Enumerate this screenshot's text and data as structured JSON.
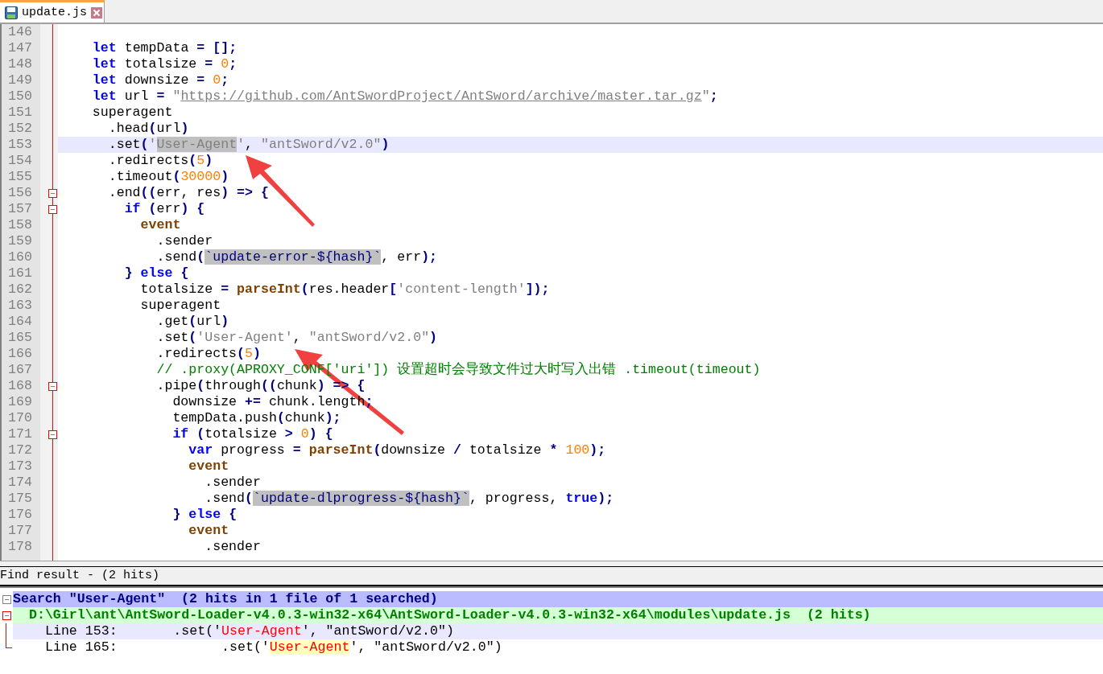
{
  "tabs": [
    {
      "label": "update.js",
      "selected": true
    }
  ],
  "editor": {
    "lines": [
      {
        "number": "146",
        "fold": false,
        "current": false
      },
      {
        "number": "147",
        "fold": false,
        "current": false,
        "tokens": [
          {
            "kind": "kw",
            "text": "    let"
          },
          {
            "kind": "txt",
            "text": " tempData "
          },
          {
            "kind": "op",
            "text": "= [];"
          }
        ]
      },
      {
        "number": "148",
        "fold": false,
        "current": false,
        "tokens": [
          {
            "kind": "kw",
            "text": "    let"
          },
          {
            "kind": "txt",
            "text": " totalsize "
          },
          {
            "kind": "op",
            "text": "= "
          },
          {
            "kind": "num",
            "text": "0"
          },
          {
            "kind": "op",
            "text": ";"
          }
        ]
      },
      {
        "number": "149",
        "fold": false,
        "current": false,
        "tokens": [
          {
            "kind": "kw",
            "text": "    let"
          },
          {
            "kind": "txt",
            "text": " downsize "
          },
          {
            "kind": "op",
            "text": "= "
          },
          {
            "kind": "num",
            "text": "0"
          },
          {
            "kind": "op",
            "text": ";"
          }
        ]
      },
      {
        "number": "150",
        "fold": false,
        "current": false,
        "tokens": [
          {
            "kind": "kw",
            "text": "    let"
          },
          {
            "kind": "txt",
            "text": " url "
          },
          {
            "kind": "op",
            "text": "= "
          },
          {
            "kind": "str",
            "text": "\""
          },
          {
            "kind": "url",
            "text": "https://github.com/AntSwordProject/AntSword/archive/master.tar.gz"
          },
          {
            "kind": "str",
            "text": "\""
          },
          {
            "kind": "op",
            "text": ";"
          }
        ]
      },
      {
        "number": "151",
        "fold": false,
        "current": false,
        "tokens": [
          {
            "kind": "txt",
            "text": "    superagent"
          }
        ]
      },
      {
        "number": "152",
        "fold": false,
        "current": false,
        "tokens": [
          {
            "kind": "txt",
            "text": "      .head"
          },
          {
            "kind": "op",
            "text": "("
          },
          {
            "kind": "txt",
            "text": "url"
          },
          {
            "kind": "op",
            "text": ")"
          }
        ]
      },
      {
        "number": "153",
        "fold": false,
        "current": true,
        "tokens": [
          {
            "kind": "txt",
            "text": "      .set"
          },
          {
            "kind": "op",
            "text": "("
          },
          {
            "kind": "str",
            "text": "'"
          },
          {
            "kind": "sel",
            "text": "User-Agent"
          },
          {
            "kind": "str",
            "text": "'"
          },
          {
            "kind": "txt",
            "text": ", "
          },
          {
            "kind": "str",
            "text": "\"antSword/v2.0\""
          },
          {
            "kind": "op",
            "text": ")"
          }
        ]
      },
      {
        "number": "154",
        "fold": false,
        "current": false,
        "tokens": [
          {
            "kind": "txt",
            "text": "      .redirects"
          },
          {
            "kind": "op",
            "text": "("
          },
          {
            "kind": "num",
            "text": "5"
          },
          {
            "kind": "op",
            "text": ")"
          }
        ]
      },
      {
        "number": "155",
        "fold": false,
        "current": false,
        "tokens": [
          {
            "kind": "txt",
            "text": "      .timeout"
          },
          {
            "kind": "op",
            "text": "("
          },
          {
            "kind": "num",
            "text": "30000"
          },
          {
            "kind": "op",
            "text": ")"
          }
        ]
      },
      {
        "number": "156",
        "fold": true,
        "current": false,
        "tokens": [
          {
            "kind": "txt",
            "text": "      .end"
          },
          {
            "kind": "op",
            "text": "(("
          },
          {
            "kind": "txt",
            "text": "err, res"
          },
          {
            "kind": "op",
            "text": ") => {"
          }
        ]
      },
      {
        "number": "157",
        "fold": true,
        "current": false,
        "tokens": [
          {
            "kind": "kw",
            "text": "        if"
          },
          {
            "kind": "op",
            "text": " ("
          },
          {
            "kind": "txt",
            "text": "err"
          },
          {
            "kind": "op",
            "text": ") {"
          }
        ]
      },
      {
        "number": "158",
        "fold": false,
        "current": false,
        "tokens": [
          {
            "kind": "fn",
            "text": "          event"
          }
        ]
      },
      {
        "number": "159",
        "fold": false,
        "current": false,
        "tokens": [
          {
            "kind": "txt",
            "text": "            .sender"
          }
        ]
      },
      {
        "number": "160",
        "fold": false,
        "current": false,
        "tokens": [
          {
            "kind": "txt",
            "text": "            .send"
          },
          {
            "kind": "op",
            "text": "("
          },
          {
            "kind": "tpl",
            "text": "`update-error-${hash}`"
          },
          {
            "kind": "txt",
            "text": ", err"
          },
          {
            "kind": "op",
            "text": ");"
          }
        ]
      },
      {
        "number": "161",
        "fold": false,
        "current": false,
        "tokens": [
          {
            "kind": "op",
            "text": "        }"
          },
          {
            "kind": "kw",
            "text": " else"
          },
          {
            "kind": "op",
            "text": " {"
          }
        ]
      },
      {
        "number": "162",
        "fold": false,
        "current": false,
        "tokens": [
          {
            "kind": "txt",
            "text": "          totalsize "
          },
          {
            "kind": "op",
            "text": "= "
          },
          {
            "kind": "fn",
            "text": "parseInt"
          },
          {
            "kind": "op",
            "text": "("
          },
          {
            "kind": "txt",
            "text": "res.header"
          },
          {
            "kind": "op",
            "text": "["
          },
          {
            "kind": "str",
            "text": "'content-length'"
          },
          {
            "kind": "op",
            "text": "]);"
          }
        ]
      },
      {
        "number": "163",
        "fold": false,
        "current": false,
        "tokens": [
          {
            "kind": "txt",
            "text": "          superagent"
          }
        ]
      },
      {
        "number": "164",
        "fold": false,
        "current": false,
        "tokens": [
          {
            "kind": "txt",
            "text": "            .get"
          },
          {
            "kind": "op",
            "text": "("
          },
          {
            "kind": "txt",
            "text": "url"
          },
          {
            "kind": "op",
            "text": ")"
          }
        ]
      },
      {
        "number": "165",
        "fold": false,
        "current": false,
        "tokens": [
          {
            "kind": "txt",
            "text": "            .set"
          },
          {
            "kind": "op",
            "text": "("
          },
          {
            "kind": "str",
            "text": "'User-Agent'"
          },
          {
            "kind": "txt",
            "text": ", "
          },
          {
            "kind": "str",
            "text": "\"antSword/v2.0\""
          },
          {
            "kind": "op",
            "text": ")"
          }
        ]
      },
      {
        "number": "166",
        "fold": false,
        "current": false,
        "tokens": [
          {
            "kind": "txt",
            "text": "            .redirects"
          },
          {
            "kind": "op",
            "text": "("
          },
          {
            "kind": "num",
            "text": "5"
          },
          {
            "kind": "op",
            "text": ")"
          }
        ]
      },
      {
        "number": "167",
        "fold": false,
        "current": false,
        "tokens": [
          {
            "kind": "cmt",
            "text": "            // .proxy(APROXY_CONF['uri']) 设置超时会导致文件过大时写入出错 .timeout(timeout)"
          }
        ]
      },
      {
        "number": "168",
        "fold": true,
        "current": false,
        "tokens": [
          {
            "kind": "txt",
            "text": "            .pipe"
          },
          {
            "kind": "op",
            "text": "("
          },
          {
            "kind": "txt",
            "text": "through"
          },
          {
            "kind": "op",
            "text": "(("
          },
          {
            "kind": "txt",
            "text": "chunk"
          },
          {
            "kind": "op",
            "text": ") => {"
          }
        ]
      },
      {
        "number": "169",
        "fold": false,
        "current": false,
        "tokens": [
          {
            "kind": "txt",
            "text": "              downsize "
          },
          {
            "kind": "op",
            "text": "+="
          },
          {
            "kind": "txt",
            "text": " chunk.length"
          },
          {
            "kind": "op",
            "text": ";"
          }
        ]
      },
      {
        "number": "170",
        "fold": false,
        "current": false,
        "tokens": [
          {
            "kind": "txt",
            "text": "              tempData.push"
          },
          {
            "kind": "op",
            "text": "("
          },
          {
            "kind": "txt",
            "text": "chunk"
          },
          {
            "kind": "op",
            "text": ");"
          }
        ]
      },
      {
        "number": "171",
        "fold": true,
        "current": false,
        "tokens": [
          {
            "kind": "kw",
            "text": "              if"
          },
          {
            "kind": "op",
            "text": " ("
          },
          {
            "kind": "txt",
            "text": "totalsize "
          },
          {
            "kind": "op",
            "text": "> "
          },
          {
            "kind": "num",
            "text": "0"
          },
          {
            "kind": "op",
            "text": ") {"
          }
        ]
      },
      {
        "number": "172",
        "fold": false,
        "current": false,
        "tokens": [
          {
            "kind": "kw",
            "text": "                var"
          },
          {
            "kind": "txt",
            "text": " progress "
          },
          {
            "kind": "op",
            "text": "= "
          },
          {
            "kind": "fn",
            "text": "parseInt"
          },
          {
            "kind": "op",
            "text": "("
          },
          {
            "kind": "txt",
            "text": "downsize "
          },
          {
            "kind": "op",
            "text": "/"
          },
          {
            "kind": "txt",
            "text": " totalsize "
          },
          {
            "kind": "op",
            "text": "* "
          },
          {
            "kind": "num",
            "text": "100"
          },
          {
            "kind": "op",
            "text": ");"
          }
        ]
      },
      {
        "number": "173",
        "fold": false,
        "current": false,
        "tokens": [
          {
            "kind": "fn",
            "text": "                event"
          }
        ]
      },
      {
        "number": "174",
        "fold": false,
        "current": false,
        "tokens": [
          {
            "kind": "txt",
            "text": "                  .sender"
          }
        ]
      },
      {
        "number": "175",
        "fold": false,
        "current": false,
        "tokens": [
          {
            "kind": "txt",
            "text": "                  .send"
          },
          {
            "kind": "op",
            "text": "("
          },
          {
            "kind": "tpl",
            "text": "`update-dlprogress-${hash}`"
          },
          {
            "kind": "txt",
            "text": ", progress, "
          },
          {
            "kind": "kw",
            "text": "true"
          },
          {
            "kind": "op",
            "text": ");"
          }
        ]
      },
      {
        "number": "176",
        "fold": false,
        "current": false,
        "tokens": [
          {
            "kind": "op",
            "text": "              }"
          },
          {
            "kind": "kw",
            "text": " else"
          },
          {
            "kind": "op",
            "text": " {"
          }
        ]
      },
      {
        "number": "177",
        "fold": false,
        "current": false,
        "tokens": [
          {
            "kind": "fn",
            "text": "                event"
          }
        ]
      },
      {
        "number": "178",
        "fold": false,
        "current": false,
        "tokens": [
          {
            "kind": "txt",
            "text": "                  .sender"
          }
        ]
      }
    ]
  },
  "find_result": {
    "title": "Find result -  (2 hits)",
    "search": {
      "text": "Search \"User-Agent\"  (2 hits in 1 file of 1 searched)",
      "expanded": true
    },
    "file": {
      "text": "D:\\Girl\\ant\\AntSword-Loader-v4.0.3-win32-x64\\AntSword-Loader-v4.0.3-win32-x64\\modules\\update.js  (2 hits)",
      "expanded": true
    },
    "hits": [
      {
        "label": "Line 153:",
        "before": "       .set('",
        "match": "User-Agent",
        "after": "', \"antSword/v2.0\")",
        "selected": true,
        "highlighted": false
      },
      {
        "label": "Line 165:",
        "before": "             .set('",
        "match": "User-Agent",
        "after": "', \"antSword/v2.0\")",
        "selected": false,
        "highlighted": true
      }
    ]
  }
}
